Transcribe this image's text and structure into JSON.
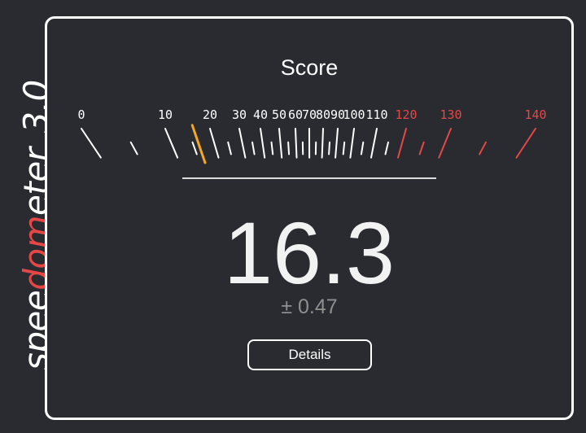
{
  "logo": {
    "pre": "spee",
    "accent": "dom",
    "post": "eter",
    "version": "3.0",
    "accent_color": "#e54747"
  },
  "panel": {
    "title": "Score"
  },
  "gauge": {
    "tick_labels": [
      "0",
      "10",
      "20",
      "30",
      "40",
      "50",
      "60",
      "70",
      "80",
      "90",
      "100",
      "110",
      "120",
      "130",
      "140"
    ],
    "danger_from": 120,
    "needle_value": 16.3,
    "colors": {
      "tick": "#ffffff",
      "danger": "#e54747",
      "needle": "#f5a623"
    }
  },
  "result": {
    "score": "16.3",
    "error": "± 0.47"
  },
  "actions": {
    "details_label": "Details"
  }
}
